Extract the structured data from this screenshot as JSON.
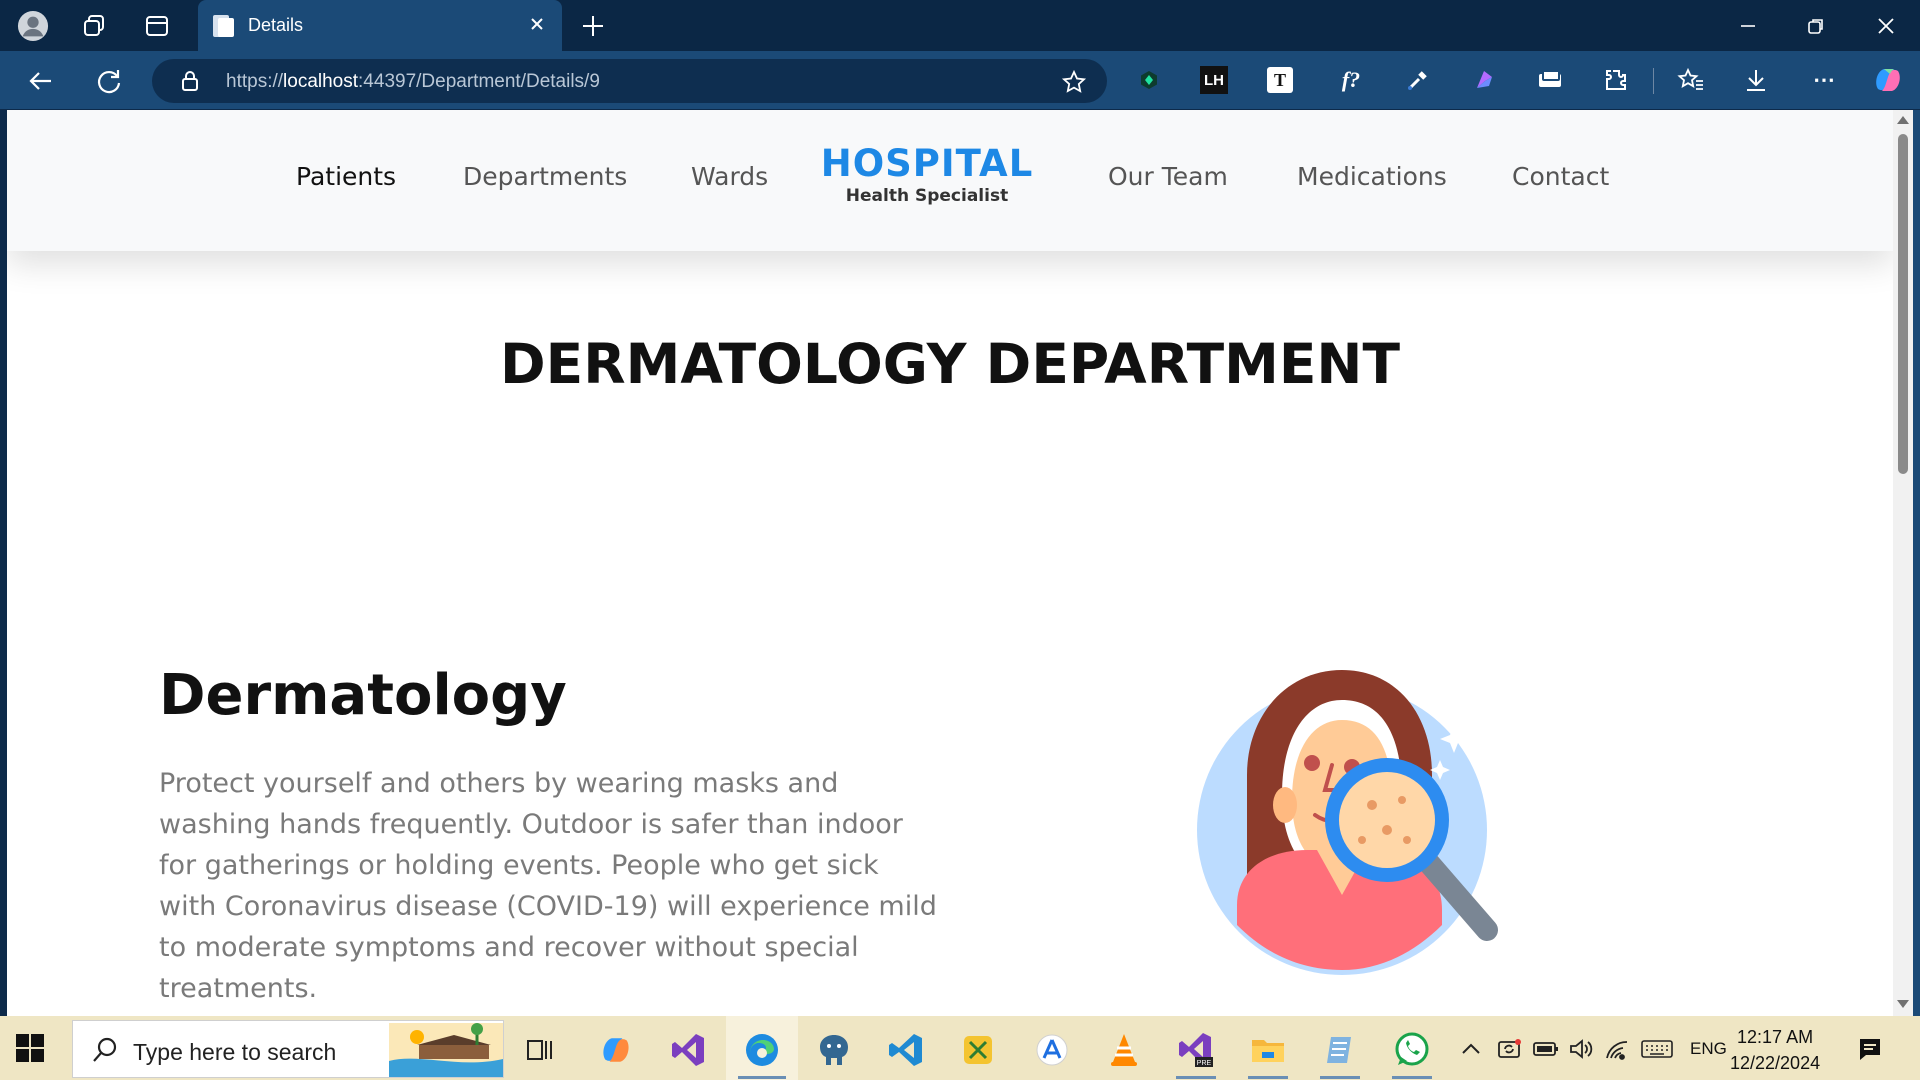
{
  "browser": {
    "tab_title": "Details",
    "url": {
      "scheme": "https://",
      "host": "localhost",
      "rest": ":44397/Department/Details/9"
    },
    "extensions": [
      "hex-extension-icon",
      "lh-extension-icon",
      "t-extension-icon",
      "font-extension-icon",
      "eyedropper-extension-icon",
      "purple-extension-icon",
      "screen-extension-icon"
    ],
    "extension_labels": {
      "lh": "LH",
      "t": "T",
      "font": "f?"
    }
  },
  "site": {
    "nav_left": [
      "Patients",
      "Departments",
      "Wards"
    ],
    "nav_right": [
      "Our Team",
      "Medications",
      "Contact"
    ],
    "active_item": "Patients",
    "logo": {
      "brand": "HOSPITAL",
      "tagline": "Health Specialist"
    },
    "brand_color": "#1e88e5"
  },
  "page": {
    "department_title": "DERMATOLOGY DEPARTMENT",
    "section_heading": "Dermatology",
    "section_text": "Protect yourself and others by wearing masks and washing hands frequently. Outdoor is safer than indoor for gatherings or holding events. People who get sick with Coronavirus disease (COVID-19) will experience mild to moderate symptoms and recover without special treatments."
  },
  "taskbar": {
    "search_placeholder": "Type here to search",
    "language": "ENG",
    "time": "12:17 AM",
    "date": "12/22/2024",
    "apps": [
      "task-view",
      "copilot",
      "visual-studio",
      "edge",
      "pgadmin",
      "vscode",
      "snipping-tool",
      "app-store",
      "vlc",
      "visual-studio-preview",
      "file-explorer",
      "notepad",
      "whatsapp"
    ]
  }
}
